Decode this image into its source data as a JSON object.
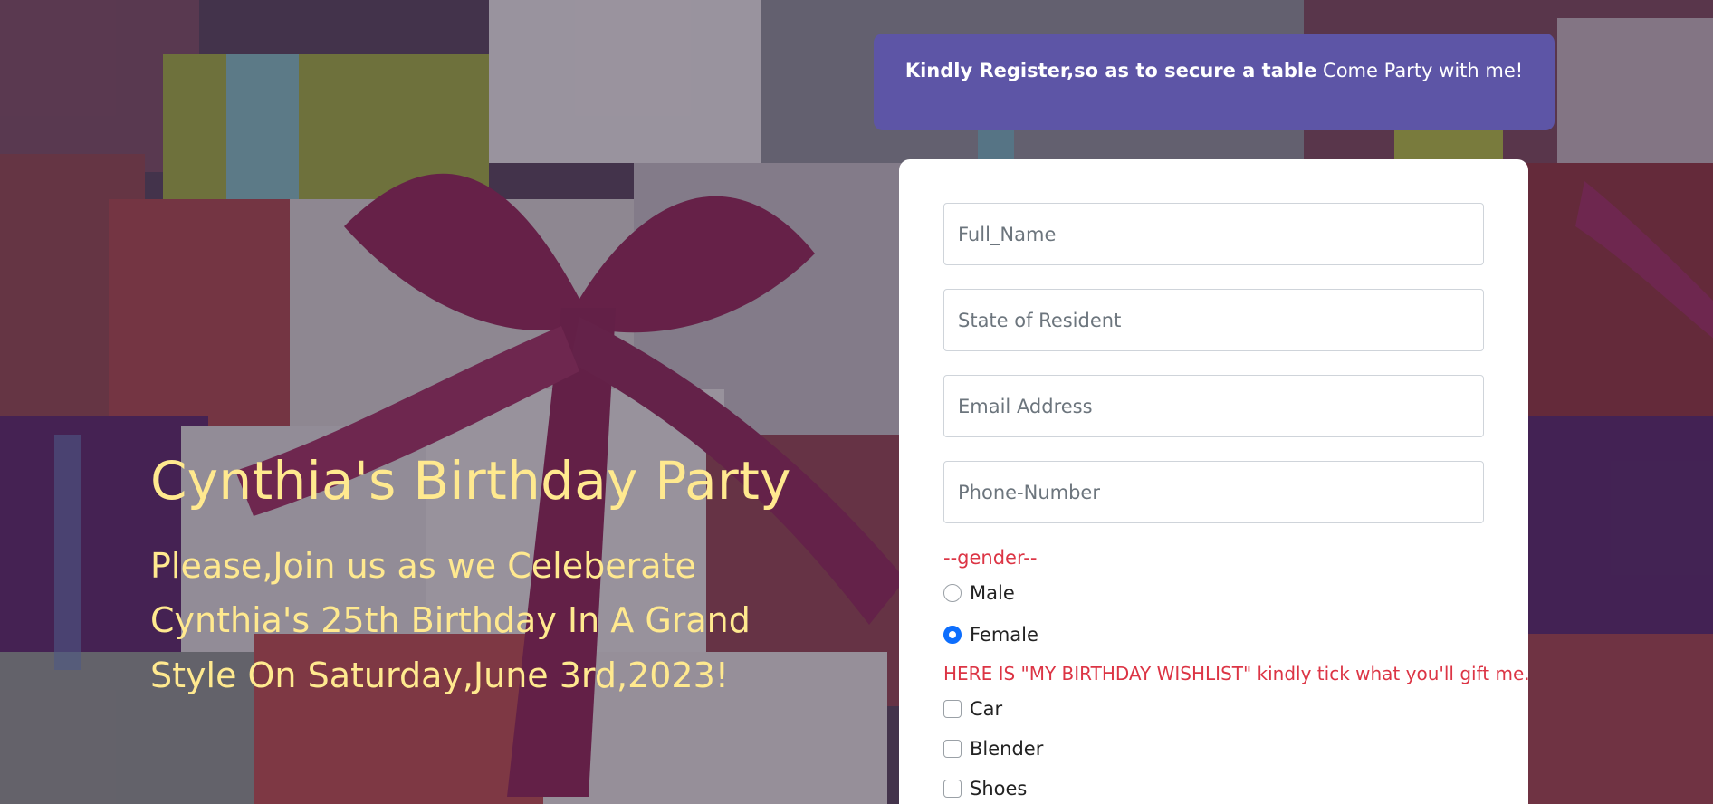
{
  "banner": {
    "bold_text": "Kindly Register,so as to secure a table",
    "text": " Come Party with me!"
  },
  "hero": {
    "title": "Cynthia's Birthday Party",
    "message": "Please,Join us as we Celeberate Cynthia's 25th Birthday In A Grand Style On Saturday,June 3rd,2023!"
  },
  "form": {
    "fields": {
      "full_name_placeholder": "Full_Name",
      "state_placeholder": "State of Resident",
      "email_placeholder": "Email Address",
      "phone_placeholder": "Phone-Number"
    },
    "gender": {
      "label": "--gender--",
      "options": [
        {
          "label": "Male",
          "checked": false
        },
        {
          "label": "Female",
          "checked": true
        }
      ]
    },
    "wishlist": {
      "label": "HERE IS \"MY BIRTHDAY WISHLIST\" kindly tick what you'll gift me.",
      "items": [
        {
          "label": "Car",
          "checked": false
        },
        {
          "label": "Blender",
          "checked": false
        },
        {
          "label": "Shoes",
          "checked": false
        }
      ]
    }
  },
  "colors": {
    "hero_text": "#ffe98f",
    "banner_bg": "#5d55a6",
    "label_red": "#dc3545",
    "radio_accent": "#0d6efd"
  }
}
